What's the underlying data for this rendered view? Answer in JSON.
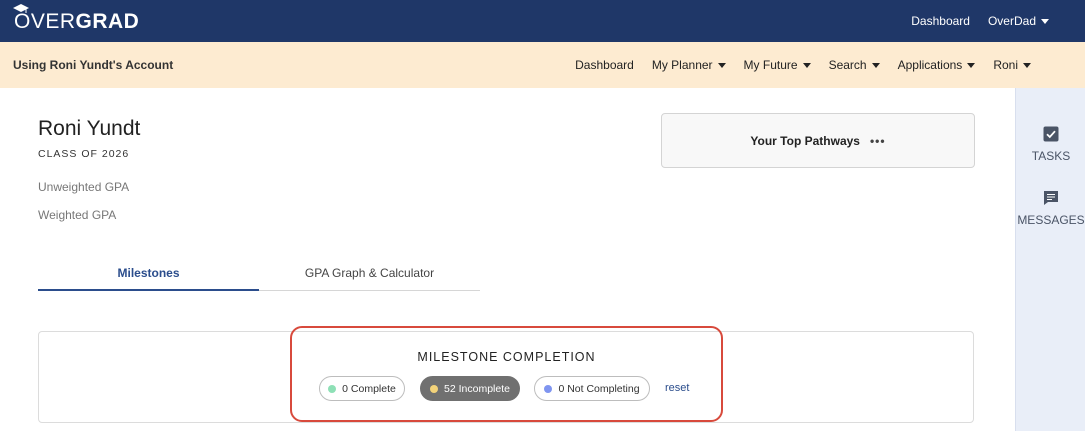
{
  "brand": {
    "logo_over": "OVER",
    "logo_grad": "GRAD"
  },
  "top_nav": {
    "dashboard": "Dashboard",
    "user": "OverDad"
  },
  "account_bar": {
    "label": "Using Roni Yundt's Account",
    "nav": [
      "Dashboard",
      "My Planner",
      "My Future",
      "Search",
      "Applications",
      "Roni"
    ]
  },
  "right_panel": {
    "tasks": "TASKS",
    "messages": "MESSAGES"
  },
  "student": {
    "name": "Roni Yundt",
    "class_of": "CLASS OF 2026",
    "unweighted_gpa_label": "Unweighted GPA",
    "weighted_gpa_label": "Weighted GPA"
  },
  "pathways": {
    "title": "Your Top Pathways",
    "more": "•••"
  },
  "tabs": {
    "milestones": "Milestones",
    "gpa": "GPA Graph & Calculator"
  },
  "milestone_completion": {
    "title": "MILESTONE COMPLETION",
    "filters": [
      {
        "label": "0 Complete",
        "color": "#8ee0b6",
        "active": false
      },
      {
        "label": "52 Incomplete",
        "color": "#f3d37a",
        "active": true
      },
      {
        "label": "0 Not Completing",
        "color": "#7f95f0",
        "active": false
      }
    ],
    "reset": "reset"
  },
  "colors": {
    "header": "#1f3768",
    "account_bar": "#fdebd1",
    "accent": "#2b4d8c",
    "highlight": "#d84a3c"
  }
}
